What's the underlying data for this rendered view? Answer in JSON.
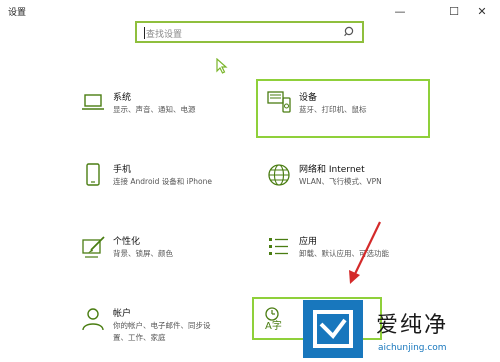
{
  "window": {
    "title": "设置",
    "controls": {
      "minimize": "—",
      "maximize": "☐",
      "close": "✕"
    }
  },
  "search": {
    "placeholder": "查找设置"
  },
  "tiles": [
    {
      "id": "system",
      "icon": "laptop-icon",
      "title": "系统",
      "desc": "显示、声音、通知、电源"
    },
    {
      "id": "devices",
      "icon": "devices-icon",
      "title": "设备",
      "desc": "蓝牙、打印机、鼠标"
    },
    {
      "id": "phone",
      "icon": "phone-icon",
      "title": "手机",
      "desc": "连接 Android 设备和 iPhone"
    },
    {
      "id": "network",
      "icon": "globe-icon",
      "title": "网络和 Internet",
      "desc": "WLAN、飞行模式、VPN"
    },
    {
      "id": "personalization",
      "icon": "brush-icon",
      "title": "个性化",
      "desc": "背景、锁屏、颜色"
    },
    {
      "id": "apps",
      "icon": "apps-list-icon",
      "title": "应用",
      "desc": "卸载、默认应用、可选功能"
    },
    {
      "id": "accounts",
      "icon": "person-icon",
      "title": "帐户",
      "desc": "你的帐户、电子邮件、同步设置、工作、家庭"
    },
    {
      "id": "time-language",
      "icon": "time-language-icon",
      "title": "",
      "desc": ""
    }
  ],
  "accent_color": "#8fbf3d",
  "watermark": {
    "brand": "爱纯净",
    "domain": "aichunjing.com"
  }
}
